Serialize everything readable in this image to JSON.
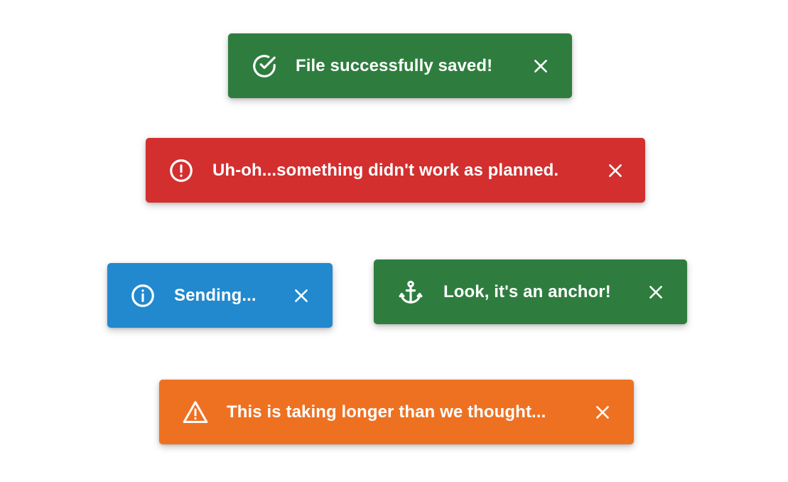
{
  "colors": {
    "success": "#2E7D3E",
    "error": "#D32F2F",
    "info": "#2289CE",
    "warning": "#EE7122",
    "text": "#FFFFFF"
  },
  "toasts": [
    {
      "type": "success",
      "icon": "check-circle-icon",
      "message": "File successfully saved!"
    },
    {
      "type": "error",
      "icon": "error-circle-icon",
      "message": "Uh-oh...something didn't work as planned."
    },
    {
      "type": "info",
      "icon": "info-circle-icon",
      "message": "Sending..."
    },
    {
      "type": "success",
      "icon": "anchor-icon",
      "message": "Look, it's an anchor!"
    },
    {
      "type": "warning",
      "icon": "warning-triangle-icon",
      "message": "This is taking longer than we thought..."
    }
  ]
}
